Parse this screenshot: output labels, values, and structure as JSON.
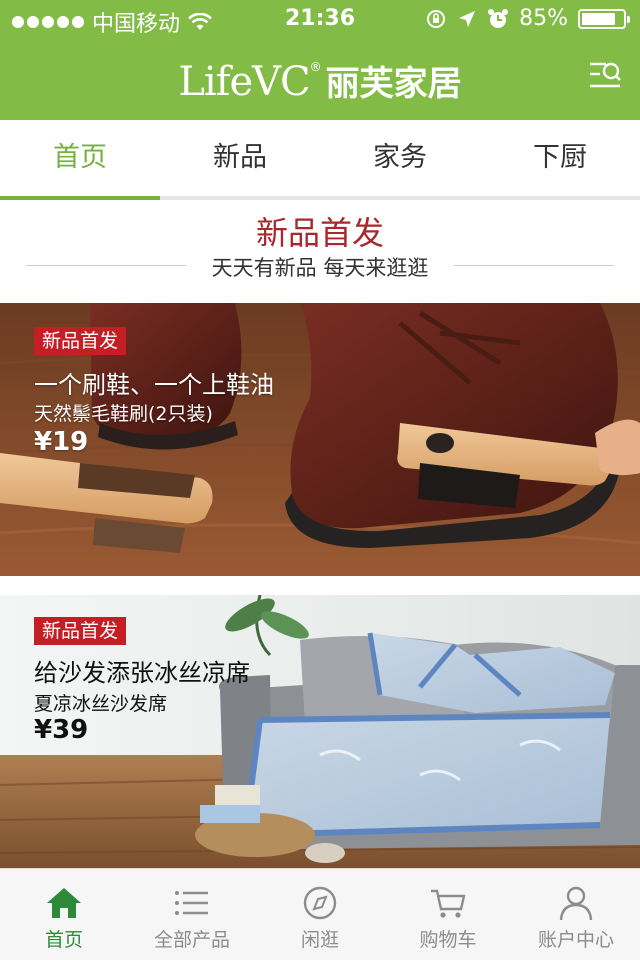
{
  "status_bar": {
    "carrier": "中国移动",
    "time": "21:36",
    "battery": "85%",
    "battery_level": 0.85
  },
  "header": {
    "logo_en": "LifeVC",
    "logo_reg": "®",
    "logo_cn": "丽芙家居",
    "menu_icon": "search-menu-icon",
    "bg_color": "#82bc47"
  },
  "tabs": [
    {
      "label": "首页",
      "active": true
    },
    {
      "label": "新品",
      "active": false
    },
    {
      "label": "家务",
      "active": false
    },
    {
      "label": "下厨",
      "active": false
    }
  ],
  "section": {
    "title": "新品首发",
    "subtitle": "天天有新品 每天来逛逛"
  },
  "banners": [
    {
      "badge": "新品首发",
      "title": "一个刷鞋、一个上鞋油",
      "subtitle": "天然鬃毛鞋刷(2只装)",
      "price": "¥19"
    },
    {
      "badge": "新品首发",
      "title": "给沙发添张冰丝凉席",
      "subtitle": "夏凉冰丝沙发席",
      "price": "¥39"
    }
  ],
  "bottom_nav": [
    {
      "label": "首页",
      "icon": "home-icon",
      "active": true
    },
    {
      "label": "全部产品",
      "icon": "list-icon",
      "active": false
    },
    {
      "label": "闲逛",
      "icon": "compass-icon",
      "active": false
    },
    {
      "label": "购物车",
      "icon": "cart-icon",
      "active": false
    },
    {
      "label": "账户中心",
      "icon": "user-icon",
      "active": false
    }
  ],
  "colors": {
    "accent_green": "#76b043",
    "badge_red": "#c51f26",
    "title_red": "#a8282d"
  }
}
